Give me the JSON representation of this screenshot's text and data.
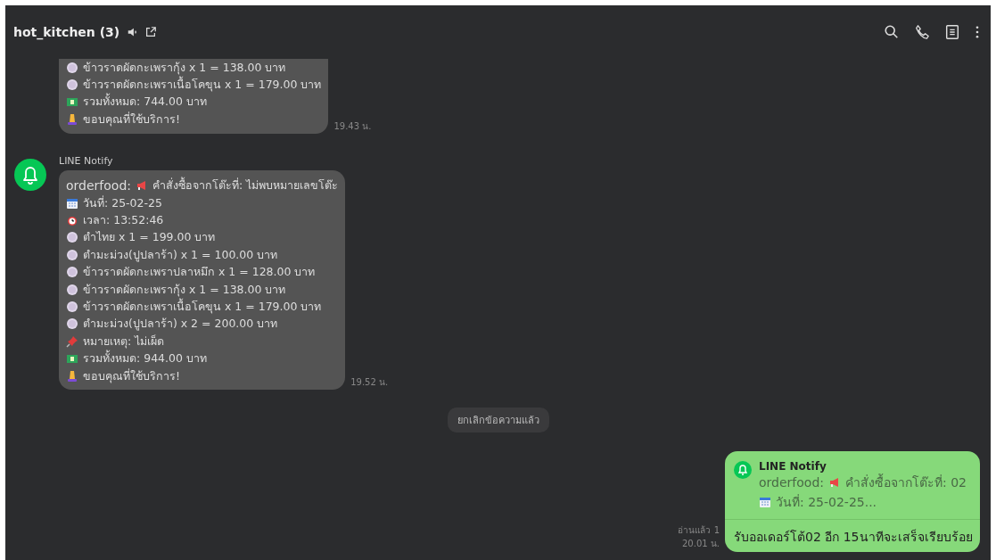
{
  "header": {
    "title": "hot_kitchen (3)"
  },
  "messages": [
    {
      "kind": "incoming",
      "continued": true,
      "time": "19.43 น.",
      "lines": [
        {
          "kind": "dish",
          "text": "ข้าวราดผัดกะเพรากุ้ง x 1 =  138.00 บาท"
        },
        {
          "kind": "dish",
          "text": "ข้าวราดผัดกะเพราเนื้อโคขุน x 1 =  179.00 บาท"
        },
        {
          "kind": "money",
          "text": "รวมทั้งหมด: 744.00 บาท"
        },
        {
          "kind": "pray",
          "text": "ขอบคุณที่ใช้บริการ!"
        }
      ]
    },
    {
      "kind": "incoming",
      "continued": false,
      "sender": "LINE Notify",
      "time": "19.52 น.",
      "lines": [
        {
          "prefix": "orderfood:",
          "kind": "megaphone",
          "text": "คำสั่งซื้อจากโต๊ะที่: ไม่พบหมายเลขโต๊ะ"
        },
        {
          "kind": "calendar",
          "text": "วันที่: 25-02-25"
        },
        {
          "kind": "clock",
          "text": "เวลา: 13:52:46"
        },
        {
          "kind": "dish",
          "text": "ตำไทย x 1 =  199.00 บาท"
        },
        {
          "kind": "dish",
          "text": "ตำมะม่วง(ปูปลาร้า) x 1 =  100.00 บาท"
        },
        {
          "kind": "dish",
          "text": "ข้าวราดผัดกะเพราปลาหมึก x 1 =  128.00 บาท"
        },
        {
          "kind": "dish",
          "text": "ข้าวราดผัดกะเพรากุ้ง x 1 =  138.00 บาท"
        },
        {
          "kind": "dish",
          "text": "ข้าวราดผัดกะเพราเนื้อโคขุน x 1 =  179.00 บาท"
        },
        {
          "kind": "dish",
          "text": "ตำมะม่วง(ปูปลาร้า) x 2 =  200.00 บาท"
        },
        {
          "kind": "pin",
          "text": "หมายเหตุ: ไม่เผ็ด"
        },
        {
          "kind": "money",
          "text": "รวมทั้งหมด: 944.00 บาท"
        },
        {
          "kind": "pray",
          "text": "ขอบคุณที่ใช้บริการ!"
        }
      ]
    },
    {
      "kind": "system",
      "text": "ยกเลิกข้อความแล้ว"
    },
    {
      "kind": "outgoing",
      "read": "อ่านแล้ว 1",
      "time": "20.01 น.",
      "reply": {
        "sender": "LINE Notify",
        "lines": [
          {
            "prefix": "orderfood:",
            "kind": "megaphone",
            "text": "คำสั่งซื้อจากโต๊ะที่: 02"
          },
          {
            "kind": "calendar",
            "text": "วันที่: 25-02-25..."
          }
        ]
      },
      "text": "รับออเดอร์โต้02  อีก 15นาทีจะเสร็จเรียบร้อย"
    }
  ]
}
